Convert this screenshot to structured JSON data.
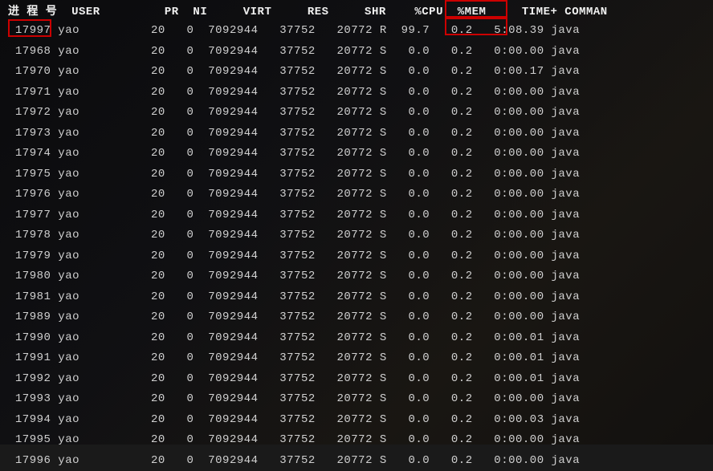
{
  "header": {
    "pid": "进 程 号",
    "user": "USER",
    "pr": "PR",
    "ni": "NI",
    "virt": "VIRT",
    "res": "RES",
    "shr": "SHR",
    "s": " ",
    "cpu": "%CPU",
    "mem": "%MEM",
    "time": "TIME+",
    "command": "COMMAN"
  },
  "rows": [
    {
      "pid": "17997",
      "user": "yao",
      "pr": "20",
      "ni": "0",
      "virt": "7092944",
      "res": "37752",
      "shr": "20772",
      "s": "R",
      "cpu": "99.7",
      "mem": "0.2",
      "time": "5:08.39",
      "command": "java"
    },
    {
      "pid": "17968",
      "user": "yao",
      "pr": "20",
      "ni": "0",
      "virt": "7092944",
      "res": "37752",
      "shr": "20772",
      "s": "S",
      "cpu": "0.0",
      "mem": "0.2",
      "time": "0:00.00",
      "command": "java"
    },
    {
      "pid": "17970",
      "user": "yao",
      "pr": "20",
      "ni": "0",
      "virt": "7092944",
      "res": "37752",
      "shr": "20772",
      "s": "S",
      "cpu": "0.0",
      "mem": "0.2",
      "time": "0:00.17",
      "command": "java"
    },
    {
      "pid": "17971",
      "user": "yao",
      "pr": "20",
      "ni": "0",
      "virt": "7092944",
      "res": "37752",
      "shr": "20772",
      "s": "S",
      "cpu": "0.0",
      "mem": "0.2",
      "time": "0:00.00",
      "command": "java"
    },
    {
      "pid": "17972",
      "user": "yao",
      "pr": "20",
      "ni": "0",
      "virt": "7092944",
      "res": "37752",
      "shr": "20772",
      "s": "S",
      "cpu": "0.0",
      "mem": "0.2",
      "time": "0:00.00",
      "command": "java"
    },
    {
      "pid": "17973",
      "user": "yao",
      "pr": "20",
      "ni": "0",
      "virt": "7092944",
      "res": "37752",
      "shr": "20772",
      "s": "S",
      "cpu": "0.0",
      "mem": "0.2",
      "time": "0:00.00",
      "command": "java"
    },
    {
      "pid": "17974",
      "user": "yao",
      "pr": "20",
      "ni": "0",
      "virt": "7092944",
      "res": "37752",
      "shr": "20772",
      "s": "S",
      "cpu": "0.0",
      "mem": "0.2",
      "time": "0:00.00",
      "command": "java"
    },
    {
      "pid": "17975",
      "user": "yao",
      "pr": "20",
      "ni": "0",
      "virt": "7092944",
      "res": "37752",
      "shr": "20772",
      "s": "S",
      "cpu": "0.0",
      "mem": "0.2",
      "time": "0:00.00",
      "command": "java"
    },
    {
      "pid": "17976",
      "user": "yao",
      "pr": "20",
      "ni": "0",
      "virt": "7092944",
      "res": "37752",
      "shr": "20772",
      "s": "S",
      "cpu": "0.0",
      "mem": "0.2",
      "time": "0:00.00",
      "command": "java"
    },
    {
      "pid": "17977",
      "user": "yao",
      "pr": "20",
      "ni": "0",
      "virt": "7092944",
      "res": "37752",
      "shr": "20772",
      "s": "S",
      "cpu": "0.0",
      "mem": "0.2",
      "time": "0:00.00",
      "command": "java"
    },
    {
      "pid": "17978",
      "user": "yao",
      "pr": "20",
      "ni": "0",
      "virt": "7092944",
      "res": "37752",
      "shr": "20772",
      "s": "S",
      "cpu": "0.0",
      "mem": "0.2",
      "time": "0:00.00",
      "command": "java"
    },
    {
      "pid": "17979",
      "user": "yao",
      "pr": "20",
      "ni": "0",
      "virt": "7092944",
      "res": "37752",
      "shr": "20772",
      "s": "S",
      "cpu": "0.0",
      "mem": "0.2",
      "time": "0:00.00",
      "command": "java"
    },
    {
      "pid": "17980",
      "user": "yao",
      "pr": "20",
      "ni": "0",
      "virt": "7092944",
      "res": "37752",
      "shr": "20772",
      "s": "S",
      "cpu": "0.0",
      "mem": "0.2",
      "time": "0:00.00",
      "command": "java"
    },
    {
      "pid": "17981",
      "user": "yao",
      "pr": "20",
      "ni": "0",
      "virt": "7092944",
      "res": "37752",
      "shr": "20772",
      "s": "S",
      "cpu": "0.0",
      "mem": "0.2",
      "time": "0:00.00",
      "command": "java"
    },
    {
      "pid": "17989",
      "user": "yao",
      "pr": "20",
      "ni": "0",
      "virt": "7092944",
      "res": "37752",
      "shr": "20772",
      "s": "S",
      "cpu": "0.0",
      "mem": "0.2",
      "time": "0:00.00",
      "command": "java"
    },
    {
      "pid": "17990",
      "user": "yao",
      "pr": "20",
      "ni": "0",
      "virt": "7092944",
      "res": "37752",
      "shr": "20772",
      "s": "S",
      "cpu": "0.0",
      "mem": "0.2",
      "time": "0:00.01",
      "command": "java"
    },
    {
      "pid": "17991",
      "user": "yao",
      "pr": "20",
      "ni": "0",
      "virt": "7092944",
      "res": "37752",
      "shr": "20772",
      "s": "S",
      "cpu": "0.0",
      "mem": "0.2",
      "time": "0:00.01",
      "command": "java"
    },
    {
      "pid": "17992",
      "user": "yao",
      "pr": "20",
      "ni": "0",
      "virt": "7092944",
      "res": "37752",
      "shr": "20772",
      "s": "S",
      "cpu": "0.0",
      "mem": "0.2",
      "time": "0:00.01",
      "command": "java"
    },
    {
      "pid": "17993",
      "user": "yao",
      "pr": "20",
      "ni": "0",
      "virt": "7092944",
      "res": "37752",
      "shr": "20772",
      "s": "S",
      "cpu": "0.0",
      "mem": "0.2",
      "time": "0:00.00",
      "command": "java"
    },
    {
      "pid": "17994",
      "user": "yao",
      "pr": "20",
      "ni": "0",
      "virt": "7092944",
      "res": "37752",
      "shr": "20772",
      "s": "S",
      "cpu": "0.0",
      "mem": "0.2",
      "time": "0:00.03",
      "command": "java"
    },
    {
      "pid": "17995",
      "user": "yao",
      "pr": "20",
      "ni": "0",
      "virt": "7092944",
      "res": "37752",
      "shr": "20772",
      "s": "S",
      "cpu": "0.0",
      "mem": "0.2",
      "time": "0:00.00",
      "command": "java"
    },
    {
      "pid": "17996",
      "user": "yao",
      "pr": "20",
      "ni": "0",
      "virt": "7092944",
      "res": "37752",
      "shr": "20772",
      "s": "S",
      "cpu": "0.0",
      "mem": "0.2",
      "time": "0:00.00",
      "command": "java"
    }
  ]
}
